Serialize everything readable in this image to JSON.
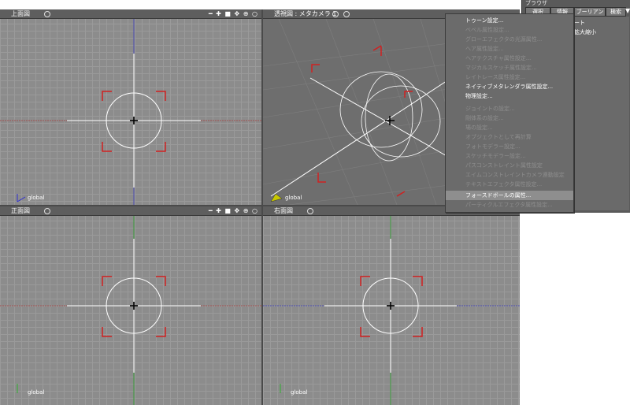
{
  "viewports": {
    "top": {
      "title": "上面図",
      "axis_label": "global",
      "tools": "━ ✚ ■ ✥ ⊕ ○"
    },
    "persp": {
      "title": "透視図 : メタカメラ 1",
      "axis_label": "global"
    },
    "front": {
      "title": "正面図",
      "axis_label": "global",
      "tools": "━ ✚ ■ ✥ ⊕ ○"
    },
    "right": {
      "title": "右面図",
      "axis_label": "global",
      "tools": "━ ✚ ■ ✥ ⊕ ○"
    }
  },
  "context_menu": {
    "items": [
      {
        "label": "トゥーン設定...",
        "enabled": true
      },
      {
        "label": "ベベル属性設定...",
        "enabled": false
      },
      {
        "label": "グローエフェクタの光源属性...",
        "enabled": false
      },
      {
        "label": "ヘア属性設定...",
        "enabled": false
      },
      {
        "label": "ヘアテクスチャ属性設定...",
        "enabled": false
      },
      {
        "label": "マジカルスケッチ属性設定...",
        "enabled": false
      },
      {
        "label": "レイトレース属性設定...",
        "enabled": false
      },
      {
        "label": "ネイティブメタレンダラ属性設定...",
        "enabled": true
      },
      {
        "label": "物理設定...",
        "enabled": true
      },
      {
        "label": "ジョイントの設定...",
        "enabled": false
      },
      {
        "label": "剛体系の設定...",
        "enabled": false
      },
      {
        "label": "場の設定...",
        "enabled": false
      },
      {
        "label": "オブジェクトとして再計算",
        "enabled": false
      },
      {
        "label": "フォトモデラー設定...",
        "enabled": false
      },
      {
        "label": "スケッチモデラー設定...",
        "enabled": false
      },
      {
        "label": "パスコンストレイント属性設定",
        "enabled": false
      },
      {
        "label": "エイムコンストレイントカメラ連動設定",
        "enabled": false
      },
      {
        "label": "テキストエフェクタ属性設定...",
        "enabled": false
      },
      {
        "label": "フォースドボールの属性...",
        "enabled": true,
        "highlighted": true
      },
      {
        "label": "パーティクルエフェクタ属性設定...",
        "enabled": false
      }
    ]
  },
  "browser_panel": {
    "title": "ブラウザ",
    "tabs": [
      "選択",
      "情報",
      "ブーリアン",
      "検索"
    ],
    "rows": [
      "ート",
      "拡大縮小"
    ]
  }
}
